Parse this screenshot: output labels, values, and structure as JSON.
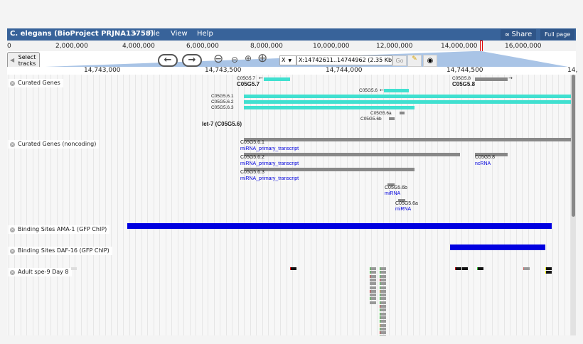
{
  "menubar": {
    "title": "C. elegans (BioProject PRJNA13758)",
    "menus": [
      "File",
      "View",
      "Help"
    ],
    "share": "Share",
    "full_page": "Full page"
  },
  "overview": {
    "ticks": [
      "0",
      "2,000,000",
      "4,000,000",
      "6,000,000",
      "8,000,000",
      "10,000,000",
      "12,000,000",
      "14,000,000",
      "16,000,000"
    ],
    "marker_color": "#e00000"
  },
  "nav": {
    "select_tracks": "Select tracks",
    "ref_seq": "X",
    "location": "X:14742611..14744962 (2.35 Kb",
    "go": "Go"
  },
  "detail": {
    "ticks": [
      "14,743,000",
      "14,743,500",
      "14,744,000",
      "14,744,500",
      "14,"
    ]
  },
  "tracks": [
    {
      "label": "Curated Genes",
      "features": [
        "C05G5.7",
        "C05G5.7",
        "C05G5.8",
        "C05G5.8",
        "C05G5.6",
        "C05G5.6.1",
        "C05G5.6.2",
        "C05G5.6.3",
        "C05G5.6a",
        "C05G5.6b",
        "let-7 (C05G5.6)"
      ],
      "color": "#40e0d0"
    },
    {
      "label": "Curated Genes (noncoding)",
      "features": [
        {
          "name": "C05G5.6.1",
          "type": "miRNA_primary_transcript"
        },
        {
          "name": "C05G5.6.2",
          "type": "miRNA_primary_transcript"
        },
        {
          "name": "C05G5.8",
          "type": "ncRNA"
        },
        {
          "name": "C05G5.6.3",
          "type": "miRNA_primary_transcript"
        },
        {
          "name": "C05G5.6b",
          "type": "miRNA"
        },
        {
          "name": "C05G5.6a",
          "type": "miRNA"
        }
      ]
    },
    {
      "label": "Binding Sites AMA-1 (GFP ChIP)",
      "color": "#0000e0"
    },
    {
      "label": "Binding Sites DAF-16 (GFP ChIP)",
      "color": "#0000e0"
    },
    {
      "label": "Adult spe-9 Day 8"
    }
  ]
}
